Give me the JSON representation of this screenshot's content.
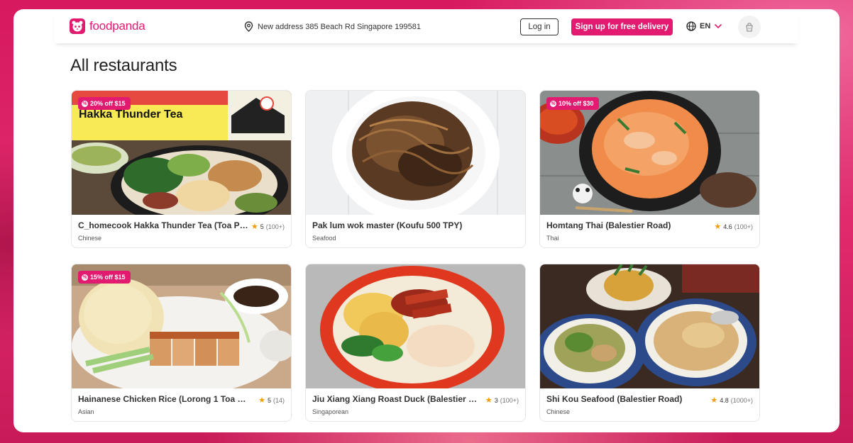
{
  "header": {
    "logo_text": "foodpanda",
    "address": "New address 385 Beach Rd Singapore 199581",
    "login_label": "Log in",
    "signup_label": "Sign up for free delivery",
    "language": "EN"
  },
  "main": {
    "title": "All restaurants",
    "restaurants": [
      {
        "name": "C_homecook Hakka Thunder Tea (Toa Pa...",
        "cuisine": "Chinese",
        "rating": "5",
        "rating_count": "(100+)",
        "promo": "20% off $15",
        "image_text": "Hakka Thunder Tea"
      },
      {
        "name": "Pak lum wok master (Koufu 500 TPY)",
        "cuisine": "Seafood",
        "rating": "",
        "rating_count": "",
        "promo": ""
      },
      {
        "name": "Homtang Thai (Balestier Road)",
        "cuisine": "Thai",
        "rating": "4.6",
        "rating_count": "(100+)",
        "promo": "10% off $30"
      },
      {
        "name": "Hainanese Chicken Rice (Lorong 1 Toa Pay...",
        "cuisine": "Asian",
        "rating": "5",
        "rating_count": "(14)",
        "promo": "15% off $15"
      },
      {
        "name": "Jiu Xiang Xiang Roast Duck (Balestier Rd)",
        "cuisine": "Singaporean",
        "rating": "3",
        "rating_count": "(100+)",
        "promo": ""
      },
      {
        "name": "Shi Kou Seafood (Balestier Road)",
        "cuisine": "Chinese",
        "rating": "4.8",
        "rating_count": "(1000+)",
        "promo": ""
      }
    ]
  },
  "colors": {
    "brand": "#e21b70",
    "star": "#f59d00"
  },
  "icons": [
    "panda-logo-icon",
    "location-pin-icon",
    "globe-icon",
    "chevron-down-icon",
    "cart-icon",
    "star-icon",
    "promo-tag-icon"
  ]
}
